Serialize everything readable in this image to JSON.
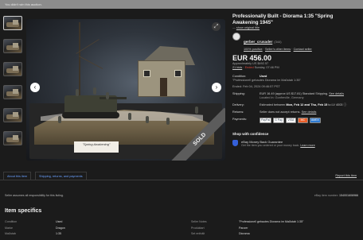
{
  "notice": "You didn't win this auction.",
  "title": "Professionally Built - Diorama 1:35 \"Spring Awakening 1945\"",
  "show_original": "show original title",
  "seller": {
    "name": "gerber_crusader",
    "feedback": "(344)",
    "positive": "100% positive",
    "other_items": "Seller's other items",
    "contact": "Contact seller"
  },
  "price": "EUR 456.00",
  "approx": "Approximately US $492.57",
  "bids": "21 bids",
  "ended_label": "Ended",
  "ended_date": "Sunday, 07:46 PM",
  "condition": {
    "label": "Condition:",
    "value": "Used",
    "note": "\"Professionell gebautes Diorama im Maßstab 1:35\""
  },
  "ended_line": "Ended: Feb 04, 2024 09:46:57 PST",
  "shipping": {
    "label": "Shipping:",
    "value": "EUR 16.49 (approx US $17.81) Standard Shipping.",
    "details": "See details",
    "location": "Located in: Gonfreville, Germany"
  },
  "delivery": {
    "label": "Delivery:",
    "value_pre": "Estimated between",
    "value_bold": "Mon, Feb 12 and Thu, Feb 15",
    "value_post": "to LV 4003",
    "icon": "info-icon"
  },
  "returns": {
    "label": "Returns:",
    "value": "Seller does not accept returns.",
    "details": "See details"
  },
  "payments": {
    "label": "Payments:",
    "methods": [
      "PayPal",
      "G Pay",
      "VISA",
      "MC",
      "AMEX"
    ]
  },
  "confidence": {
    "header": "Shop with confidence",
    "title": "eBay Money Back Guarantee",
    "desc": "Get the item you ordered or your money back.",
    "learn": "Learn more"
  },
  "plaque": "\"Spring Awakening\"",
  "sold": "SOLD",
  "tabs": [
    "About this item",
    "Shipping, returns, and payments"
  ],
  "report": "Report this item",
  "responsibility": "Seller assumes all responsibility for this listing.",
  "item_number_label": "eBay item number:",
  "item_number": "154001606966",
  "specifics_title": "Item specifics",
  "specifics": [
    {
      "l1": "Condition",
      "v1": "Used",
      "l2": "Seller Notes",
      "v2": "\"Professionell gebautes Diorama im Maßstab 1:35\""
    },
    {
      "l1": "Marke",
      "v1": "Dragon",
      "l2": "Produktart",
      "v2": "Panzer"
    },
    {
      "l1": "Maßstab",
      "v1": "1:35",
      "l2": "Set enthält",
      "v2": "Diorama"
    }
  ],
  "colors": {
    "accent": "#3560d9",
    "link": "#6aa0ff",
    "red": "#e0493c"
  }
}
